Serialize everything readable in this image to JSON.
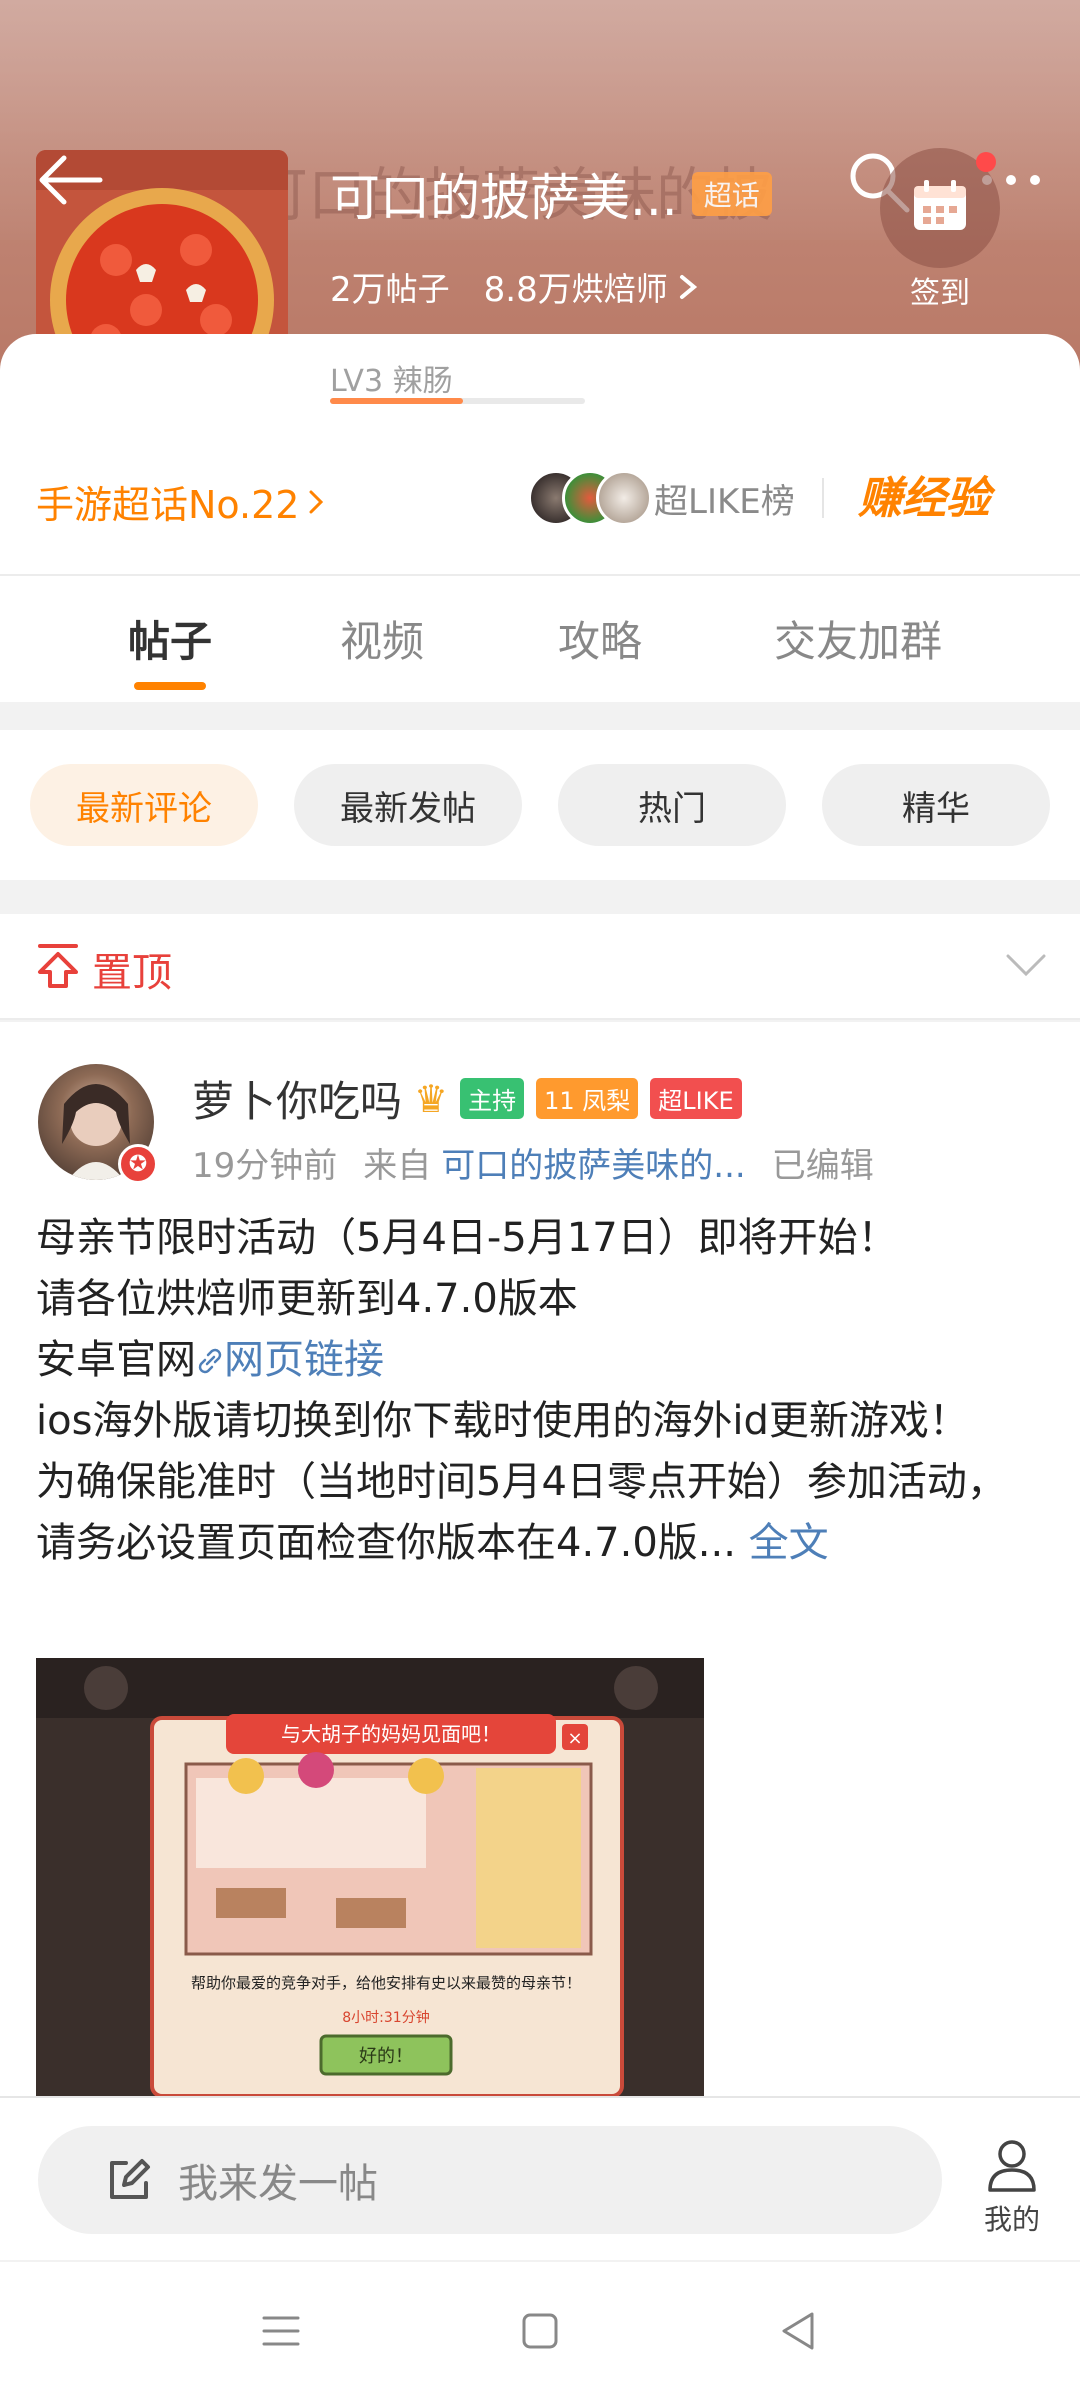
{
  "header": {
    "title": "可口的披萨美...",
    "ghost_title": "可口的披萨美味的披",
    "super_badge": "超话",
    "posts_count": "2万",
    "posts_label": "帖子",
    "bakers_count": "8.8万",
    "bakers_label": "烘焙师",
    "checkin_label": "签到"
  },
  "level": {
    "label": "LV3 辣肠",
    "progress": 0.52
  },
  "rank": {
    "label": "手游超话No.22"
  },
  "like_board": {
    "label": "超LIKE榜"
  },
  "earn": {
    "label": "赚经验"
  },
  "tabs": [
    {
      "label": "帖子",
      "active": true
    },
    {
      "label": "视频",
      "active": false
    },
    {
      "label": "攻略",
      "active": false
    },
    {
      "label": "交友加群",
      "active": false
    }
  ],
  "filters": [
    {
      "label": "最新评论",
      "active": true
    },
    {
      "label": "最新发帖",
      "active": false
    },
    {
      "label": "热门",
      "active": false
    },
    {
      "label": "精华",
      "active": false
    }
  ],
  "pinned": {
    "label": "置顶"
  },
  "post": {
    "username": "萝卜你吃吗",
    "tag_host": "主持",
    "tag_fan_level": "11",
    "tag_fan": "凤梨",
    "tag_like": "超LIKE",
    "time": "19分钟前",
    "from_label": "来自",
    "source": "可口的披萨美味的...",
    "edited": "已编辑",
    "line1": "母亲节限时活动（5月4日-5月17日）即将开始！",
    "line2": "请各位烘焙师更新到4.7.0版本",
    "line3_prefix": "安卓官网",
    "line3_link": "网页链接",
    "line4": "ios海外版请切换到你下载时使用的海外id更新游戏！",
    "line5": "为确保能准时（当地时间5月4日零点开始）参加活动，请务必设置页面检查你版本在4.7.0版...",
    "more": "全文",
    "image": {
      "banner": "与大胡子的妈妈见面吧！",
      "caption": "帮助你最爱的竞争对手，给他安排有史以来最赞的母亲节！",
      "timer": "8小时:31分钟",
      "ok_button": "好的！"
    }
  },
  "bottom": {
    "compose_placeholder": "我来发一帖",
    "me_label": "我的"
  },
  "colors": {
    "accent": "#ff8200",
    "pin_red": "#e8413b",
    "link_blue": "#4e7fb8"
  }
}
